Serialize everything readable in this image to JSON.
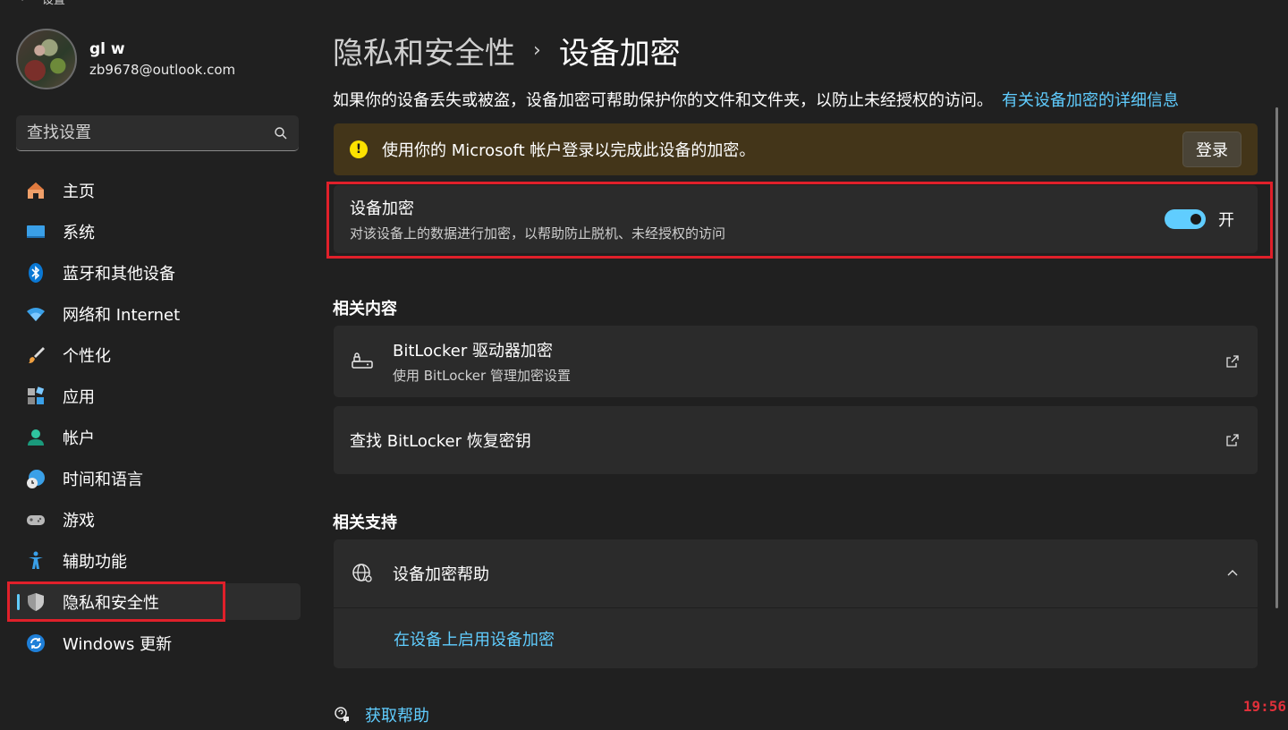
{
  "window": {
    "title": "设置",
    "back_glyph": "←"
  },
  "profile": {
    "name": "gl w",
    "email": "zb9678@outlook.com"
  },
  "search": {
    "placeholder": "查找设置"
  },
  "sidebar": {
    "items": [
      {
        "label": "主页",
        "icon": "home-icon"
      },
      {
        "label": "系统",
        "icon": "system-icon"
      },
      {
        "label": "蓝牙和其他设备",
        "icon": "bluetooth-icon"
      },
      {
        "label": "网络和 Internet",
        "icon": "wifi-icon"
      },
      {
        "label": "个性化",
        "icon": "brush-icon"
      },
      {
        "label": "应用",
        "icon": "apps-icon"
      },
      {
        "label": "帐户",
        "icon": "account-icon"
      },
      {
        "label": "时间和语言",
        "icon": "globe-clock-icon"
      },
      {
        "label": "游戏",
        "icon": "gamepad-icon"
      },
      {
        "label": "辅助功能",
        "icon": "accessibility-icon"
      },
      {
        "label": "隐私和安全性",
        "icon": "shield-icon",
        "active": true
      },
      {
        "label": "Windows 更新",
        "icon": "update-icon"
      }
    ]
  },
  "main": {
    "breadcrumb": {
      "parent": "隐私和安全性",
      "separator": "›",
      "current": "设备加密"
    },
    "description": "如果你的设备丢失或被盗，设备加密可帮助保护你的文件和文件夹，以防止未经授权的访问。",
    "description_link": "有关设备加密的详细信息",
    "banner": {
      "icon_glyph": "!",
      "text": "使用你的 Microsoft 帐户登录以完成此设备的加密。",
      "button": "登录"
    },
    "device_encryption": {
      "title": "设备加密",
      "subtitle": "对该设备上的数据进行加密，以帮助防止脱机、未经授权的访问",
      "toggle_label": "开",
      "toggle_on": true
    },
    "related_content": {
      "title": "相关内容",
      "bitlocker": {
        "title": "BitLocker 驱动器加密",
        "subtitle": "使用 BitLocker 管理加密设置"
      },
      "recovery_key": {
        "title": "查找 BitLocker 恢复密钥"
      }
    },
    "related_support": {
      "title": "相关支持",
      "help": {
        "title": "设备加密帮助",
        "link": "在设备上启用设备加密"
      }
    },
    "get_help": "获取帮助"
  },
  "overlay": {
    "clock": "19:56"
  },
  "colors": {
    "accent": "#60cdff",
    "highlight_box": "#e0202a",
    "banner_bg": "#433519",
    "warning": "#fce100"
  }
}
